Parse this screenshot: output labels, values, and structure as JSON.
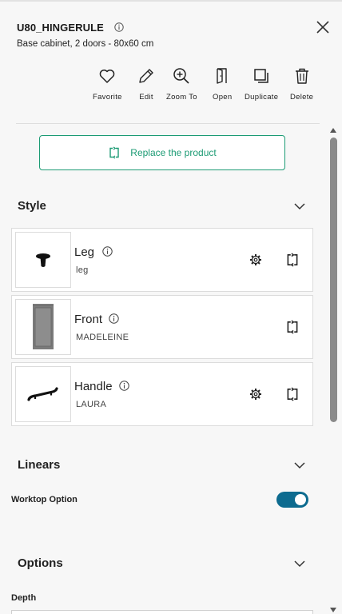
{
  "header": {
    "title": "U80_HINGERULE",
    "subtitle": "Base cabinet, 2 doors - 80x60 cm"
  },
  "toolbar": [
    {
      "label": "Favorite",
      "icon": "heart-icon"
    },
    {
      "label": "Edit",
      "icon": "pencil-icon"
    },
    {
      "label": "Zoom To",
      "icon": "zoom-in-icon"
    },
    {
      "label": "Open",
      "icon": "door-open-icon"
    },
    {
      "label": "Duplicate",
      "icon": "duplicate-icon"
    },
    {
      "label": "Delete",
      "icon": "trash-icon"
    }
  ],
  "replace_button": {
    "label": "Replace the product",
    "icon": "swap-icon"
  },
  "sections": {
    "style": {
      "title": "Style"
    },
    "linears": {
      "title": "Linears"
    },
    "options": {
      "title": "Options"
    }
  },
  "style_items": [
    {
      "title": "Leg",
      "subtitle": "leg",
      "has_settings": true
    },
    {
      "title": "Front",
      "subtitle": "MADELEINE",
      "has_settings": false
    },
    {
      "title": "Handle",
      "subtitle": "LAURA",
      "has_settings": true
    }
  ],
  "linears": {
    "worktop_label": "Worktop Option",
    "worktop_enabled": true
  },
  "options": {
    "depth_label": "Depth"
  },
  "colors": {
    "accent": "#1c9b74",
    "toggle_on": "#0d6b8f"
  }
}
